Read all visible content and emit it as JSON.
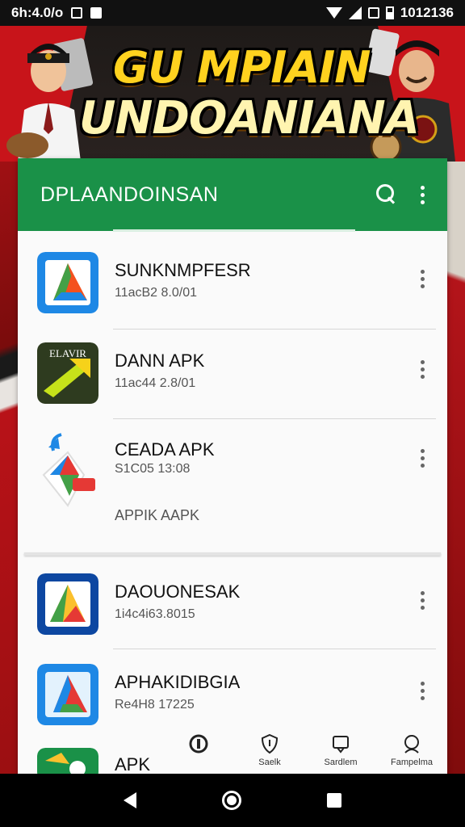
{
  "status_bar": {
    "time_left": "6h:4.0/o",
    "time_right": "1012136"
  },
  "banner": {
    "line1": "GU MPIAIN",
    "line2": "UNDOANIANA"
  },
  "appbar": {
    "title": "DPLAANDOINSAN"
  },
  "apps": [
    {
      "name": "SUNKNMPFESR",
      "sub": "11acB2 8.0/01",
      "icon_colors": [
        "#1e88e5",
        "#f4511e",
        "#43a047"
      ]
    },
    {
      "name": "DANN APK",
      "sub": "11ac44 2.8/01",
      "badge": "ELAVIR",
      "icon_colors": [
        "#2e3b1f",
        "#c6e21a",
        "#f6d21a"
      ]
    },
    {
      "name": "CEADA APK",
      "sub": "S1C05 13:08",
      "extra": "APPIK AAPK",
      "icon_colors": [
        "#1e88e5",
        "#e53935",
        "#43a047"
      ]
    },
    {
      "name": "DAOUONESAK",
      "sub": "1i4c4i63.8015",
      "icon_colors": [
        "#1565c0",
        "#fbc02d",
        "#e53935"
      ]
    },
    {
      "name": "APHAKIDIBGIA",
      "sub": "Re4H8 17225",
      "icon_colors": [
        "#1e88e5",
        "#e53935",
        "#43a047"
      ]
    },
    {
      "name": "APK",
      "sub": ""
    }
  ],
  "bottom_nav": [
    {
      "label": "",
      "icon": "circle-o-icon"
    },
    {
      "label": "Saelk",
      "icon": "shield-icon"
    },
    {
      "label": "Sardlem",
      "icon": "chat-icon"
    },
    {
      "label": "Fampelma",
      "icon": "profile-icon"
    }
  ]
}
